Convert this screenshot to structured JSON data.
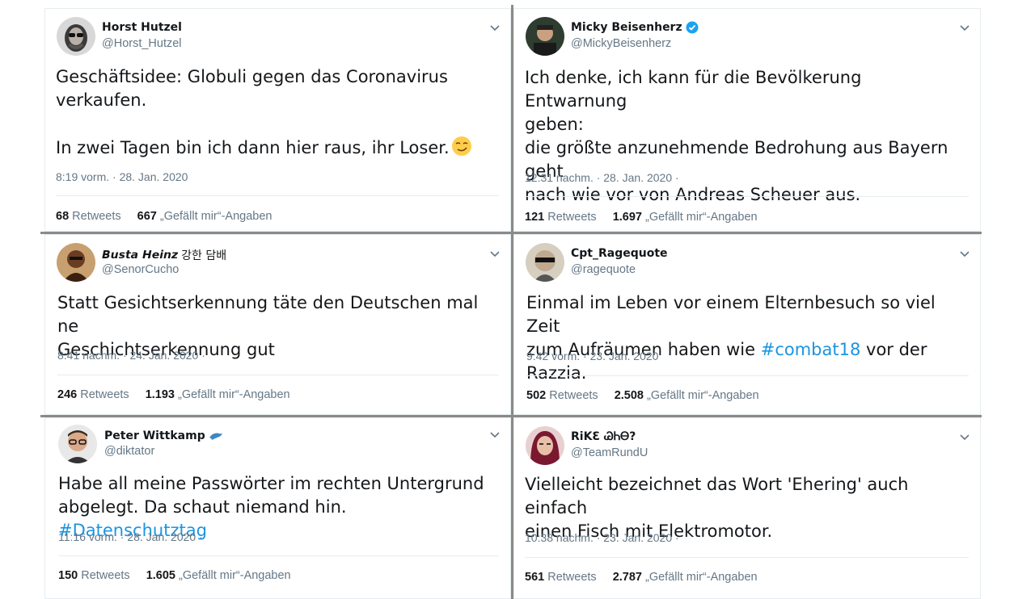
{
  "tweets": [
    {
      "name": "Horst Hutzel",
      "name_extra": "",
      "handle": "@Horst_Hutzel",
      "text_lines": "Geschäftsidee: Globuli gegen das Coronavirus\nverkaufen.\n\nIn zwei Tagen bin ich dann hier raus, ihr Loser.",
      "time": "8:19 vorm. · 28. Jan. 2020",
      "retweets": "68",
      "retweets_label": "Retweets",
      "likes": "667",
      "likes_label": "„Gefällt mir“-Angaben"
    },
    {
      "name": "Micky Beisenherz",
      "name_extra": "",
      "handle": "@MickyBeisenherz",
      "text_lines": "Ich denke, ich kann für die Bevölkerung Entwarnung\ngeben:\ndie größte anzunehmende Bedrohung aus Bayern geht\nnach wie vor von Andreas Scheuer aus.",
      "time": "12:31 nachm. · 28. Jan. 2020 ·",
      "retweets": "121",
      "retweets_label": "Retweets",
      "likes": "1.697",
      "likes_label": "„Gefällt mir“-Angaben"
    },
    {
      "name": "𝘽𝙪𝙨𝙩𝙖 𝙃𝙚𝙞𝙣𝙯",
      "name_extra": "강한 담배",
      "handle": "@SenorCucho",
      "text_lines": "Statt Gesichtserkennung täte den Deutschen mal ne\nGeschichtserkennung gut",
      "time": "8:41 nachm. · 24. Jan. 2020 ·",
      "retweets": "246",
      "retweets_label": "Retweets",
      "likes": "1.193",
      "likes_label": "„Gefällt mir“-Angaben"
    },
    {
      "name": "Cpt_Ragequote",
      "name_extra": "",
      "handle": "@ragequote",
      "text_before": "Einmal im Leben vor einem Elternbesuch so viel Zeit\nzum Aufräumen haben wie ",
      "hashtag": "#combat18",
      "text_after": " vor der Razzia.",
      "time": "9:42 vorm. · 23. Jan. 2020",
      "retweets": "502",
      "retweets_label": "Retweets",
      "likes": "2.508",
      "likes_label": "„Gefällt mir“-Angaben"
    },
    {
      "name": "Peter Wittkamp",
      "name_extra": "",
      "handle": "@diktator",
      "text_before": "Habe all meine Passwörter im rechten Untergrund\nabgelegt. Da schaut niemand hin. ",
      "hashtag": "#Datenschutztag",
      "text_after": "",
      "time": "11:16 vorm. · 28. Jan. 2020 ·",
      "retweets": "150",
      "retweets_label": "Retweets",
      "likes": "1.605",
      "likes_label": "„Gefällt mir“-Angaben"
    },
    {
      "name": "RiKƐ ᏊᏂᎾ?",
      "name_extra": "",
      "handle": "@TeamRundU",
      "text_lines": "Vielleicht bezeichnet das Wort 'Ehering' auch einfach\neinen Fisch mit Elektromotor.",
      "time": "10:38 nachm. · 23. Jan. 2020 ·",
      "retweets": "561",
      "retweets_label": "Retweets",
      "likes": "2.787",
      "likes_label": "„Gefällt mir“-Angaben"
    }
  ],
  "colors": {
    "link": "#1b95e0",
    "secondary_text": "#657786",
    "separator": "#8a8a8a"
  },
  "icons": [
    "chevron-down-icon",
    "verified-badge-icon",
    "dolphin-emoji-icon",
    "smirk-emoji-icon"
  ]
}
